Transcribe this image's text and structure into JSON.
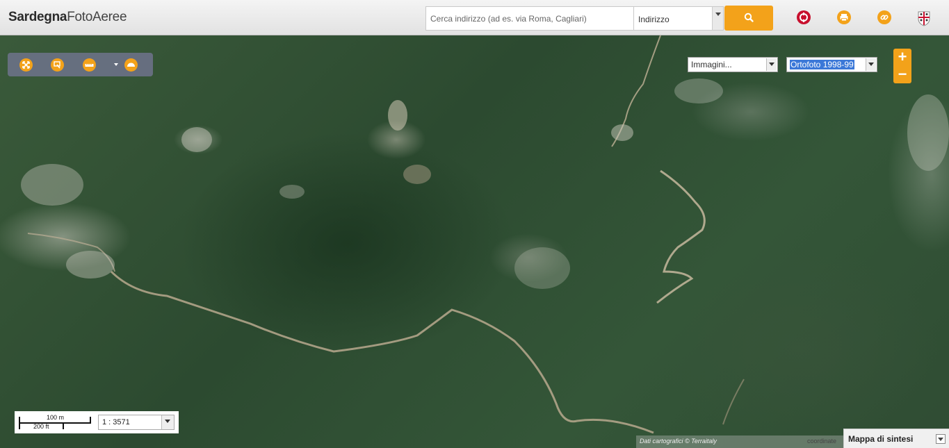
{
  "header": {
    "logo_bold": "Sardegna",
    "logo_light": "FotoAeree",
    "search_placeholder": "Cerca indirizzo (ad es. via Roma, Cagliari)",
    "search_type": "Indirizzo"
  },
  "icons": {
    "search": "search-icon",
    "help": "lifebuoy-icon",
    "print": "print-icon",
    "link": "link-icon",
    "region": "sardinia-crest-icon"
  },
  "colors": {
    "accent": "#f3a21a",
    "help_icon": "#c8102e"
  },
  "layers": {
    "category": "Immagini...",
    "ortho": "Ortofoto 1998-99"
  },
  "zoom": {
    "in": "+",
    "out": "−"
  },
  "scale": {
    "meters": "100 m",
    "feet": "200 ft",
    "ratio": "1 : 3571"
  },
  "footer": {
    "attribution": "Dati cartografici © Terraitaly",
    "coordinates": "coordinate",
    "overview": "Mappa di sintesi"
  }
}
